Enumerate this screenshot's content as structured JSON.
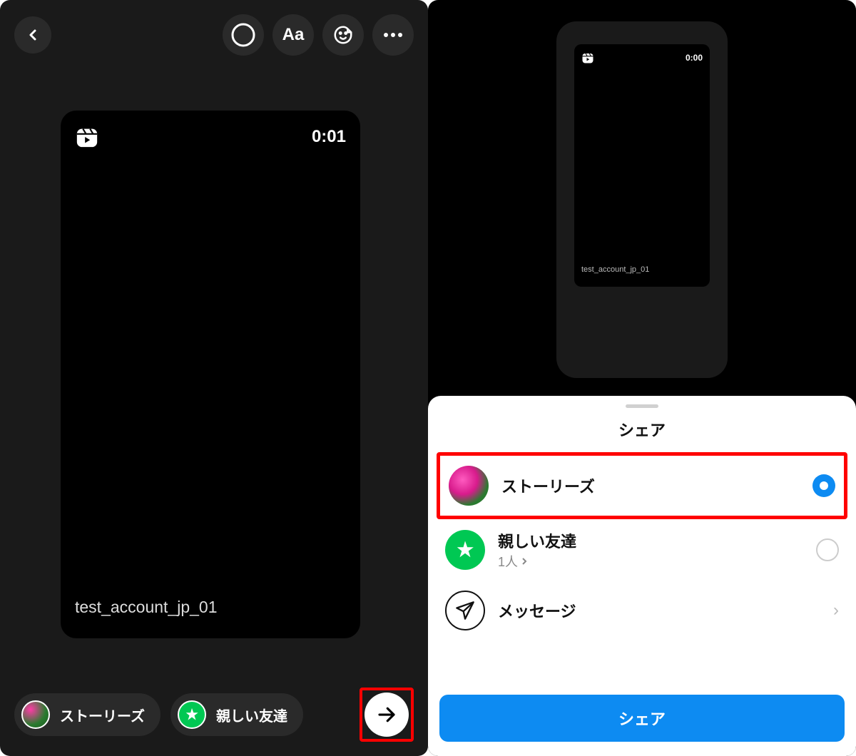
{
  "left": {
    "preview": {
      "timestamp": "0:01",
      "username": "test_account_jp_01"
    },
    "actions": {
      "stories_label": "ストーリーズ",
      "close_friends_label": "親しい友達"
    },
    "toolbar": {
      "text_label": "Aa"
    }
  },
  "right": {
    "mini_preview": {
      "timestamp": "0:00",
      "username": "test_account_jp_01"
    },
    "sheet": {
      "title": "シェア",
      "options": {
        "stories": {
          "label": "ストーリーズ"
        },
        "close_friends": {
          "label": "親しい友達",
          "sublabel": "1人"
        },
        "messages": {
          "label": "メッセージ"
        }
      },
      "share_button": "シェア"
    }
  }
}
